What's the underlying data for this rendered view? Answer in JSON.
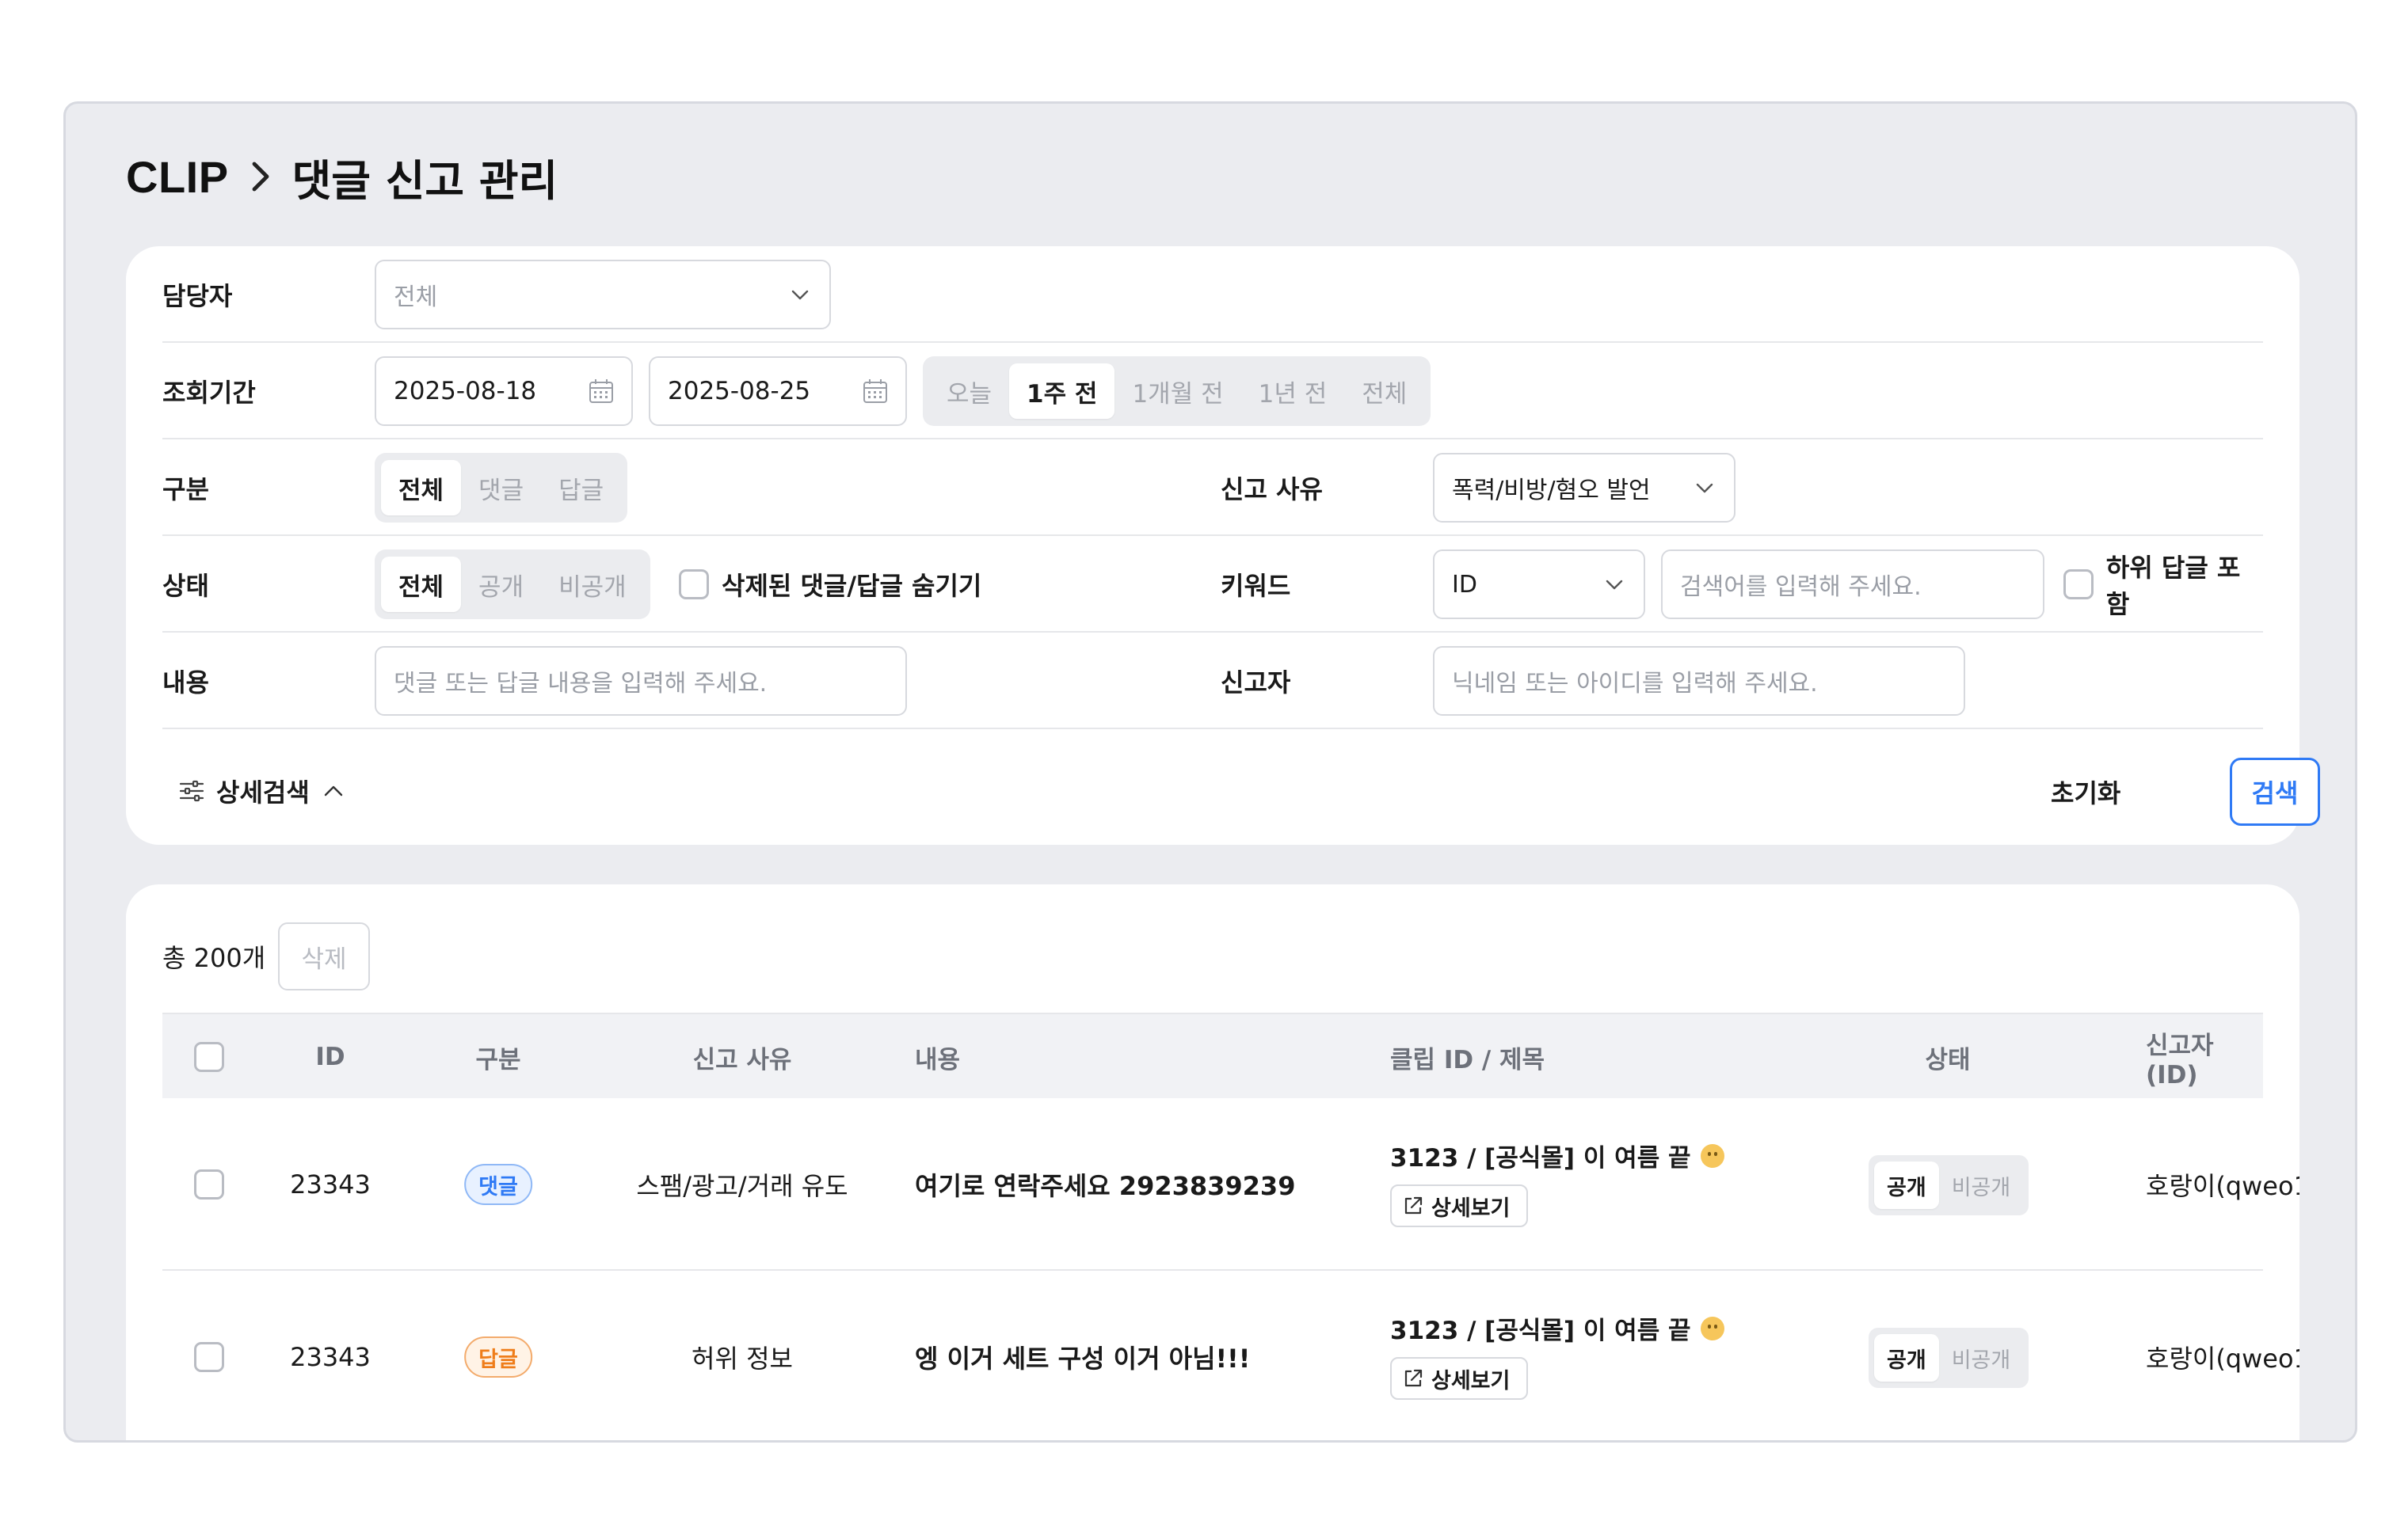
{
  "breadcrumb": {
    "root": "CLIP",
    "page": "댓글 신고 관리"
  },
  "filters": {
    "manager": {
      "label": "담당자",
      "value": "전체"
    },
    "period": {
      "label": "조회기간",
      "start": "2025-08-18",
      "end": "2025-08-25",
      "presets": [
        "오늘",
        "1주 전",
        "1개월 전",
        "1년 전",
        "전체"
      ],
      "active_preset": "1주 전"
    },
    "type": {
      "label": "구분",
      "options": [
        "전체",
        "댓글",
        "답글"
      ],
      "active": "전체"
    },
    "reason": {
      "label": "신고 사유",
      "value": "폭력/비방/혐오 발언"
    },
    "status": {
      "label": "상태",
      "options": [
        "전체",
        "공개",
        "비공개"
      ],
      "active": "전체",
      "hide_deleted_label": "삭제된 댓글/답글 숨기기"
    },
    "keyword": {
      "label": "키워드",
      "type_value": "ID",
      "placeholder": "검색어를 입력해 주세요.",
      "include_replies_label": "하위 답글 포함"
    },
    "content": {
      "label": "내용",
      "placeholder": "댓글 또는 답글 내용을 입력해 주세요."
    },
    "reporter": {
      "label": "신고자",
      "placeholder": "닉네임 또는 아이디를 입력해 주세요."
    },
    "advanced_label": "상세검색",
    "reset_label": "초기화",
    "search_label": "검색"
  },
  "list": {
    "total": "총 200개",
    "delete_label": "삭제",
    "columns": [
      "ID",
      "구분",
      "신고 사유",
      "내용",
      "클립 ID / 제목",
      "상태",
      "신고자(ID)"
    ],
    "rows": [
      {
        "id": "23343",
        "type": "댓글",
        "type_color": "blue",
        "reason": "스팸/광고/거래 유도",
        "content": "여기로 연락주세요 2923839239",
        "clip_title": "3123 / [공식몰] 이 여름 끝",
        "detail_label": "상세보기",
        "status_options": [
          "공개",
          "비공개"
        ],
        "status_active": "공개",
        "reporter": "호랑이(qweo1"
      },
      {
        "id": "23343",
        "type": "답글",
        "type_color": "orange",
        "reason": "허위 정보",
        "content": "엥 이거 세트 구성 이거 아님!!!",
        "clip_title": "3123 / [공식몰] 이 여름 끝",
        "detail_label": "상세보기",
        "status_options": [
          "공개",
          "비공개"
        ],
        "status_active": "공개",
        "reporter": "호랑이(qweo1"
      }
    ]
  },
  "colors": {
    "accent": "#2f7af5",
    "reply_badge": "#ef7d1a",
    "background": "#ebecf0"
  }
}
